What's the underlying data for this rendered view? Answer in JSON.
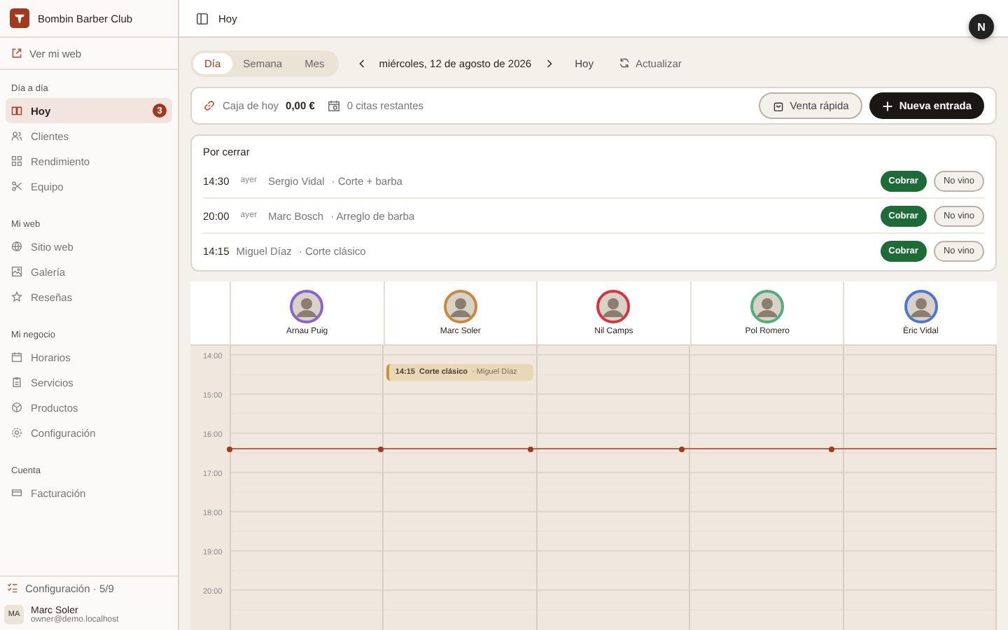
{
  "brand": {
    "name": "Bombin Barber Club"
  },
  "view_site_link": "Ver mi web",
  "nav_sections": [
    {
      "title": "Día a día",
      "items": [
        {
          "label": "Hoy",
          "selected": true,
          "badge": "3"
        },
        {
          "label": "Clientes",
          "selected": false
        },
        {
          "label": "Rendimiento",
          "selected": false
        },
        {
          "label": "Equipo",
          "selected": false
        }
      ]
    },
    {
      "title": "Mi web",
      "items": [
        {
          "label": "Sitio web",
          "selected": false
        },
        {
          "label": "Galería",
          "selected": false
        },
        {
          "label": "Reseñas",
          "selected": false
        }
      ]
    },
    {
      "title": "Mi negocio",
      "items": [
        {
          "label": "Horarios",
          "selected": false
        },
        {
          "label": "Servicios",
          "selected": false
        },
        {
          "label": "Productos",
          "selected": false
        },
        {
          "label": "Configuración",
          "selected": false
        }
      ]
    },
    {
      "title": "Cuenta",
      "items": [
        {
          "label": "Facturación",
          "selected": false
        }
      ]
    }
  ],
  "setup_progress": "Configuración · 5/9",
  "user": {
    "initials": "MA",
    "name": "Marc Soler",
    "email": "owner@demo.localhost"
  },
  "topbar": {
    "title": "Hoy",
    "avatar_letter": "N"
  },
  "view_tabs": [
    {
      "label": "Día",
      "selected": true
    },
    {
      "label": "Semana",
      "selected": false
    },
    {
      "label": "Mes",
      "selected": false
    }
  ],
  "date_nav": {
    "date": "miércoles, 12 de agosto de 2026",
    "today_button": "Hoy",
    "refresh_button": "Actualizar"
  },
  "summary": {
    "cash_label": "Caja de hoy",
    "cash_value": "0,00 €",
    "remaining": "0 citas restantes",
    "quick_sale": "Venta rápida",
    "new_entry": "Nueva entrada"
  },
  "pending": {
    "title": "Por cerrar",
    "rows": [
      {
        "time": "14:30",
        "day": "ayer",
        "client": "Sergio Vidal",
        "service": "· Corte + barba",
        "charge": "Cobrar",
        "no_show": "No vino"
      },
      {
        "time": "20:00",
        "day": "ayer",
        "client": "Marc Bosch",
        "service": "· Arreglo de barba",
        "charge": "Cobrar",
        "no_show": "No vino"
      },
      {
        "time": "14:15",
        "client": "Miguel Díaz",
        "service": "· Corte clásico",
        "charge": "Cobrar",
        "no_show": "No vino"
      }
    ]
  },
  "calendar": {
    "hours": [
      "14:00",
      "15:00",
      "16:00",
      "17:00",
      "18:00",
      "19:00",
      "20:00"
    ],
    "staff": [
      {
        "name": "Arnau Puig",
        "color": "#8a63d2"
      },
      {
        "name": "Marc Soler",
        "color": "#c98a3c",
        "appointments": [
          {
            "time": "14:15",
            "service": "Corte clásico",
            "client": "· Miguel Díaz"
          }
        ]
      },
      {
        "name": "Nil Camps",
        "color": "#d9343b"
      },
      {
        "name": "Pol Romero",
        "color": "#4fb07a"
      },
      {
        "name": "Èric Vidal",
        "color": "#4a78d8"
      }
    ]
  }
}
